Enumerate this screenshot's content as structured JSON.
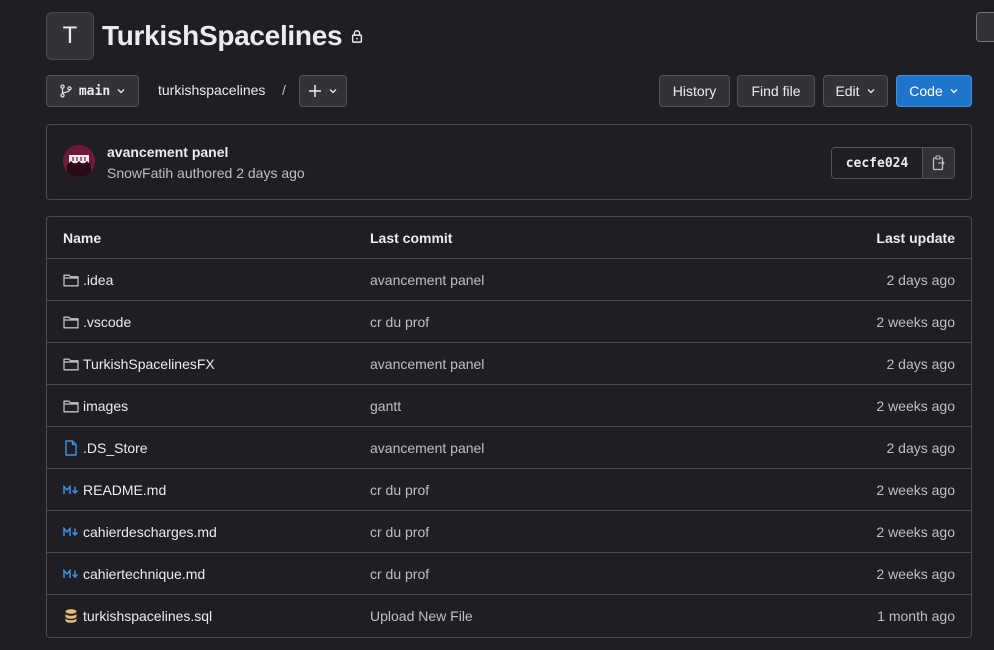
{
  "project": {
    "avatar_letter": "T",
    "title": "TurkishSpacelines"
  },
  "toolbar": {
    "branch": "main",
    "breadcrumb": "turkishspacelines",
    "separator": "/",
    "history_label": "History",
    "find_file_label": "Find file",
    "edit_label": "Edit",
    "code_label": "Code"
  },
  "last_commit": {
    "title": "avancement panel",
    "author": "SnowFatih",
    "action": "authored",
    "time": "2 days ago",
    "sha": "cecfe024"
  },
  "table": {
    "headers": {
      "name": "Name",
      "last_commit": "Last commit",
      "last_update": "Last update"
    },
    "rows": [
      {
        "icon": "folder-icon",
        "name": ".idea",
        "commit": "avancement panel",
        "updated": "2 days ago"
      },
      {
        "icon": "folder-icon",
        "name": ".vscode",
        "commit": "cr du prof",
        "updated": "2 weeks ago"
      },
      {
        "icon": "folder-icon",
        "name": "TurkishSpacelinesFX",
        "commit": "avancement panel",
        "updated": "2 days ago"
      },
      {
        "icon": "folder-icon",
        "name": "images",
        "commit": "gantt",
        "updated": "2 weeks ago"
      },
      {
        "icon": "file-icon",
        "name": ".DS_Store",
        "commit": "avancement panel",
        "updated": "2 days ago"
      },
      {
        "icon": "markdown-icon",
        "name": "README.md",
        "commit": "cr du prof",
        "updated": "2 weeks ago"
      },
      {
        "icon": "markdown-icon",
        "name": "cahierdescharges.md",
        "commit": "cr du prof",
        "updated": "2 weeks ago"
      },
      {
        "icon": "markdown-icon",
        "name": "cahiertechnique.md",
        "commit": "cr du prof",
        "updated": "2 weeks ago"
      },
      {
        "icon": "database-icon",
        "name": "turkishspacelines.sql",
        "commit": "Upload New File",
        "updated": "1 month ago"
      }
    ]
  },
  "colors": {
    "background": "#1f1e24",
    "primary_button": "#1f75cb",
    "markdown_icon": "#428fdc",
    "database_icon": "#e9be74"
  }
}
